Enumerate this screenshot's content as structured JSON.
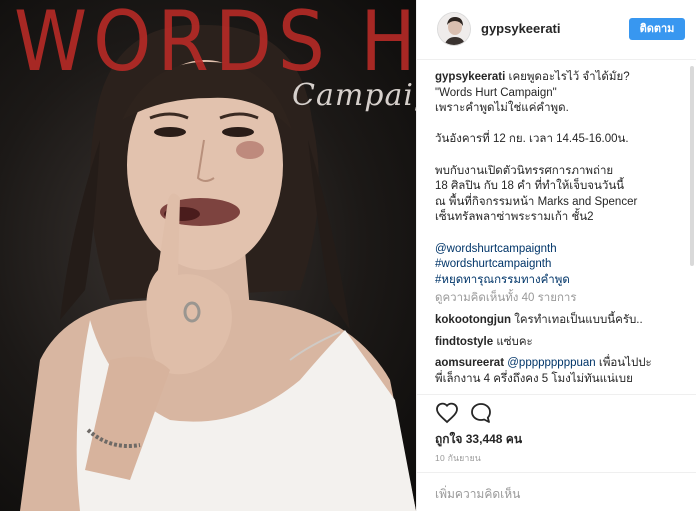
{
  "post_image": {
    "headline": "WORDS HURT",
    "subheadline": "Campaign",
    "bg_color": "#1c1917",
    "headline_color": "#b42a26"
  },
  "header": {
    "username": "gypsykeerati",
    "follow_label": "ติดตาม",
    "follow_color": "#3897f0"
  },
  "caption": {
    "username": "gypsykeerati",
    "lines": [
      "เคยพูดอะไรไว้ จำได้มั้ย?",
      "\"Words Hurt Campaign\"",
      "เพราะคำพูดไม่ใช่แค่คำพูด.",
      "",
      "วันอังคารที่ 12 กย. เวลา 14.45-16.00น.",
      "",
      "พบกับงานเปิดตัวนิทรรศการภาพถ่าย",
      "18 ศิลปิน กับ 18 คำ ที่ทำให้เจ็บจนวันนี้",
      "ณ พื้นที่กิจกรรมหน้า Marks and Spencer",
      "เซ็นทรัลพลาซ่าพระรามเก้า ชั้น2",
      ""
    ],
    "hashtags": [
      "@wordshurtcampaignth",
      "#wordshurtcampaignth",
      "#หยุดทารุณกรรมทางคำพูด"
    ]
  },
  "view_all_comments": "ดูความคิดเห็นทั้ง 40 รายการ",
  "comments": [
    {
      "username": "kokootongjun",
      "text": "ใครทำเทอเป็นแบบนี้ครับ.."
    },
    {
      "username": "findtostyle",
      "text": "แซ่บคะ"
    },
    {
      "username": "aomsureerat",
      "mention": "@pppppppppuan",
      "text": " เพื่อนไปปะ",
      "text_line2": "พี่เล็กงาน 4 ครึ่งถึงคง 5 โมงไม่ทันแน่เบย"
    }
  ],
  "actions": {
    "like_icon": "heart-outline-icon",
    "comment_icon": "speech-bubble-icon"
  },
  "likes_text": "ถูกใจ 33,448 คน",
  "date_text": "10 กันยายน",
  "add_comment_placeholder": "เพิ่มความคิดเห็น"
}
